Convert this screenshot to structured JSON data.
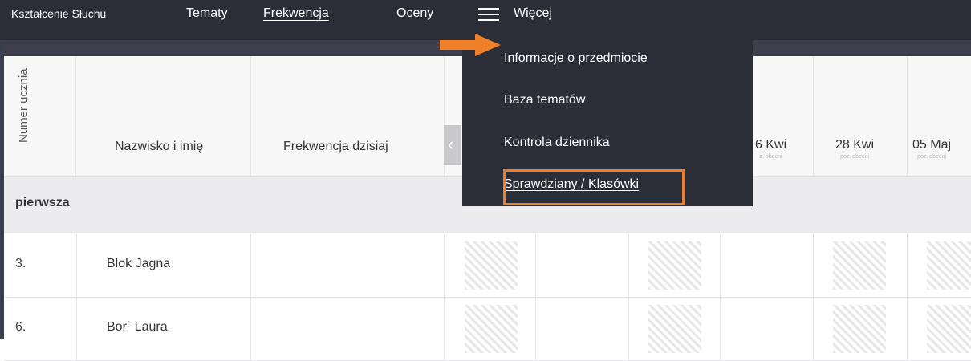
{
  "nav": {
    "brand": "Kształcenie Słuchu",
    "tabs": [
      "Tematy",
      "Frekwencja",
      "Oceny"
    ],
    "more_label": "Więcej"
  },
  "dropdown": {
    "items": [
      "Informacje o przedmiocie",
      "Baza tematów",
      "Kontrola dziennika",
      "Sprawdziany / Klasówki"
    ],
    "highlighted_item": "Sprawdziany / Klasówki",
    "highlight_color": "#f07f29"
  },
  "table": {
    "headers": {
      "number": "Numer ucznia",
      "name": "Nazwisko i imię",
      "attendance_today": "Frekwencja dzisiaj"
    },
    "dates": [
      {
        "label": "6 Kwi",
        "sub": "z. obecni"
      },
      {
        "label": "28 Kwi",
        "sub": "poz. obecni"
      },
      {
        "label": "05 Maj",
        "sub": "poz. obecni"
      }
    ],
    "group": "pierwsza",
    "students": [
      {
        "num": "3.",
        "name": "Blok Jagna"
      },
      {
        "num": "6.",
        "name": "Bor` Laura"
      }
    ]
  },
  "colors": {
    "nav_bg": "#2b2d37",
    "accent_arrow": "#f07f29"
  },
  "icons": {
    "menu": "hamburger-icon",
    "pointer": "arrow-right-icon",
    "scroll": "chevron-left-icon"
  }
}
